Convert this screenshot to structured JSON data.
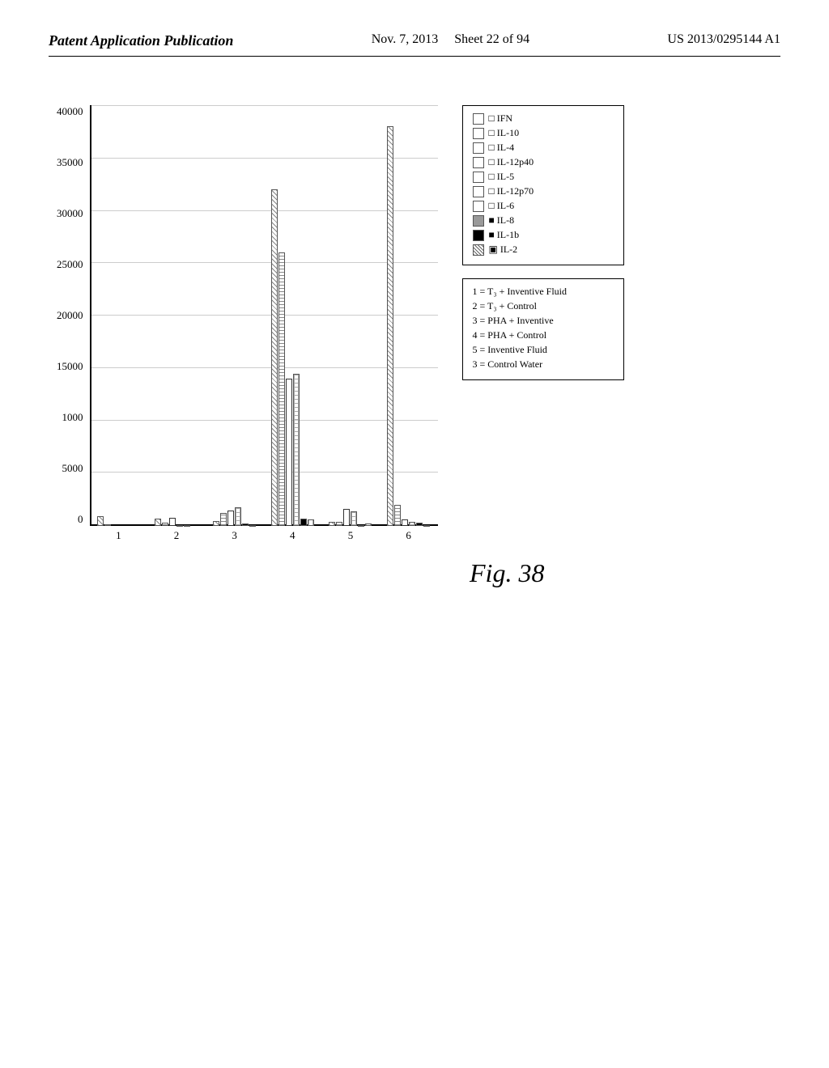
{
  "header": {
    "left": "Patent Application Publication",
    "center_date": "Nov. 7, 2013",
    "center_sheet": "Sheet 22 of 94",
    "right": "US 2013/0295144 A1"
  },
  "figure_label": "Fig. 38",
  "chart": {
    "y_axis_labels": [
      "40000",
      "35000",
      "30000",
      "25000",
      "20000",
      "15000",
      "1000",
      "5000",
      "0"
    ],
    "x_axis_labels": [
      "1",
      "2",
      "3",
      "4",
      "5",
      "6"
    ],
    "max_value": 40000,
    "groups": [
      {
        "x": 1,
        "bars": [
          {
            "value": 900,
            "type": "hatch-diagonal"
          },
          {
            "value": 150,
            "type": "hatch-horizontal"
          },
          {
            "value": 0,
            "type": "bar-outline"
          },
          {
            "value": 0,
            "type": "hatch-cross"
          },
          {
            "value": 0,
            "type": "bar-solid-black"
          },
          {
            "value": 0,
            "type": "hatch-dotted"
          }
        ]
      },
      {
        "x": 2,
        "bars": [
          {
            "value": 700,
            "type": "hatch-diagonal"
          },
          {
            "value": 300,
            "type": "hatch-horizontal"
          },
          {
            "value": 800,
            "type": "bar-outline"
          },
          {
            "value": 100,
            "type": "hatch-cross"
          },
          {
            "value": 50,
            "type": "bar-solid-black"
          },
          {
            "value": 0,
            "type": "hatch-dotted"
          }
        ]
      },
      {
        "x": 3,
        "bars": [
          {
            "value": 500,
            "type": "hatch-diagonal"
          },
          {
            "value": 1200,
            "type": "hatch-horizontal"
          },
          {
            "value": 1500,
            "type": "bar-outline"
          },
          {
            "value": 1800,
            "type": "hatch-cross"
          },
          {
            "value": 200,
            "type": "bar-solid-black"
          },
          {
            "value": 100,
            "type": "hatch-dotted"
          }
        ]
      },
      {
        "x": 4,
        "bars": [
          {
            "value": 32000,
            "type": "hatch-diagonal"
          },
          {
            "value": 26000,
            "type": "hatch-horizontal"
          },
          {
            "value": 14000,
            "type": "bar-outline"
          },
          {
            "value": 14500,
            "type": "hatch-cross"
          },
          {
            "value": 700,
            "type": "bar-solid-black"
          },
          {
            "value": 600,
            "type": "hatch-dotted"
          }
        ]
      },
      {
        "x": 5,
        "bars": [
          {
            "value": 400,
            "type": "hatch-diagonal"
          },
          {
            "value": 350,
            "type": "hatch-horizontal"
          },
          {
            "value": 1600,
            "type": "bar-outline"
          },
          {
            "value": 1400,
            "type": "hatch-cross"
          },
          {
            "value": 100,
            "type": "bar-solid-black"
          },
          {
            "value": 200,
            "type": "hatch-dotted"
          }
        ]
      },
      {
        "x": 6,
        "bars": [
          {
            "value": 38000,
            "type": "hatch-diagonal"
          },
          {
            "value": 2000,
            "type": "hatch-horizontal"
          },
          {
            "value": 600,
            "type": "bar-outline"
          },
          {
            "value": 400,
            "type": "hatch-cross"
          },
          {
            "value": 300,
            "type": "bar-solid-black"
          },
          {
            "value": 100,
            "type": "hatch-dotted"
          }
        ]
      }
    ]
  },
  "legend_top": {
    "items": [
      {
        "id": "IFN",
        "label": "IFN"
      },
      {
        "id": "IL-10",
        "label": "IL-10"
      },
      {
        "id": "IL-4",
        "label": "IL-4"
      },
      {
        "id": "IL-12p40",
        "label": "IL-12p40"
      },
      {
        "id": "IL-5",
        "label": "IL-5"
      },
      {
        "id": "IL-12p70",
        "label": "IL-12p70"
      },
      {
        "id": "IL-6",
        "label": "IL-6"
      },
      {
        "id": "IL-8",
        "label": "IL-8"
      },
      {
        "id": "IL-1b",
        "label": "IL-1b"
      },
      {
        "id": "IL-2",
        "label": "IL-2"
      }
    ]
  },
  "legend_bottom": {
    "items": [
      {
        "num": "1",
        "label": "= T₃ + Inventive Fluid"
      },
      {
        "num": "2",
        "label": "= T₃ + Control"
      },
      {
        "num": "3",
        "label": "= PHA + Inventive"
      },
      {
        "num": "4",
        "label": "= PHA + Control"
      },
      {
        "num": "5",
        "label": "= Inventive Fluid"
      },
      {
        "num": "3",
        "label": "= Control Water"
      }
    ]
  }
}
